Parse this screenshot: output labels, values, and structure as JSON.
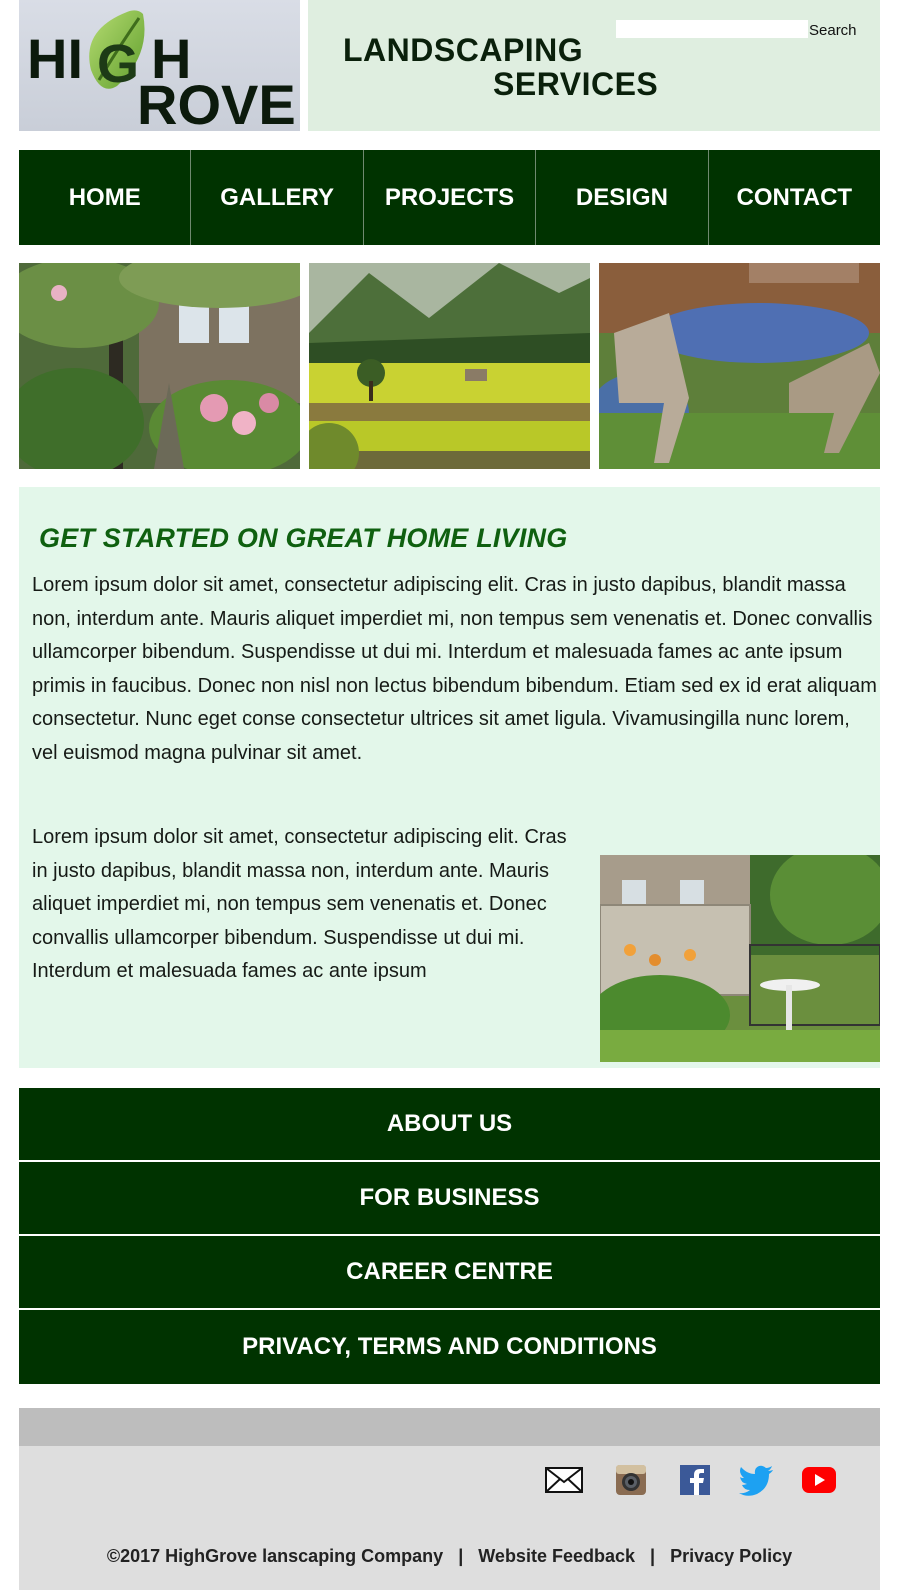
{
  "header": {
    "logo_text": "HighGrove",
    "title_line1": "LANDSCAPING",
    "title_line2": "SERVICES",
    "search": {
      "placeholder": "",
      "label": "Search"
    }
  },
  "nav": [
    {
      "label": "HOME"
    },
    {
      "label": "GALLERY"
    },
    {
      "label": "PROJECTS"
    },
    {
      "label": "DESIGN"
    },
    {
      "label": "CONTACT"
    }
  ],
  "main": {
    "heading": "GET STARTED ON GREAT HOME LIVING",
    "paragraph_1": "Lorem ipsum dolor sit amet, consectetur adipiscing elit. Cras in justo dapibus, blandit massa non, interdum ante. Mauris aliquet imperdiet mi, non tempus sem venenatis et. Donec convallis ullamcorper bibendum. Suspendisse ut dui mi. Interdum et malesuada fames ac ante ipsum primis in faucibus. Donec non nisl non lectus bibendum bibendum. Etiam sed ex id erat aliquam consectetur. Nunc eget conse consectetur ultrices sit amet ligula. Vivamusingilla nunc lorem, vel euismod magna pulvinar sit amet.",
    "paragraph_2": "Lorem ipsum dolor sit amet, consectetur adipiscing elit. Cras in justo dapibus, blandit massa non, interdum ante. Mauris aliquet imperdiet mi, non tempus sem venenatis et. Donec convallis ullamcorper bibendum. Suspendisse ut dui mi. Interdum et malesuada fames ac ante ipsum"
  },
  "footer_links": {
    "about": "ABOUT US",
    "business": "FOR BUSINESS",
    "career": "CAREER CENTRE",
    "privacy": "PRIVACY, TERMS AND CONDITIONS"
  },
  "footer": {
    "social_icons": [
      "mail-icon",
      "instagram-icon",
      "facebook-icon",
      "twitter-icon",
      "youtube-icon"
    ],
    "copyright": "©2017 HighGrove lanscaping Company",
    "separator": "|",
    "feedback_link": "Website Feedback",
    "privacy_link": "Privacy Policy"
  },
  "colors": {
    "nav_bg": "#003300",
    "content_bg": "#e3f7ea",
    "heading": "#0f6010",
    "header_panel": "#dfeee0",
    "footer_bg": "#dedede"
  }
}
